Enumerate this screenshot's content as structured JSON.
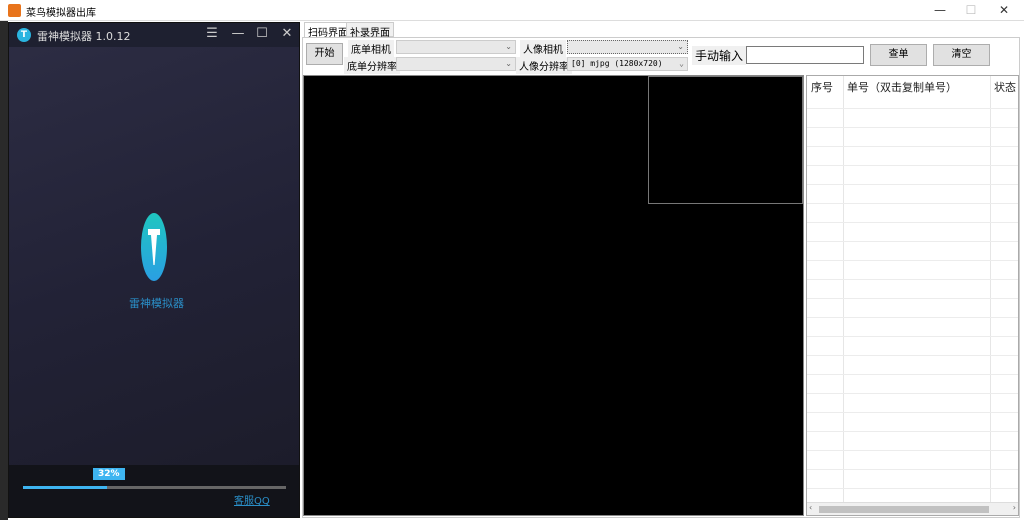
{
  "window": {
    "title": "菜鸟模拟器出库",
    "minimize": "—",
    "maximize": "☐",
    "close": "✕"
  },
  "emulator": {
    "title": "雷神模拟器 1.0.12",
    "logo_letter": "T",
    "menu": "☰",
    "minimize": "—",
    "maximize": "☐",
    "close": "✕",
    "name": "雷神模拟器",
    "progress_label": "32%",
    "progress": 0.32,
    "support_link": "客服QQ"
  },
  "tabs": [
    {
      "label": "扫码界面",
      "active": true
    },
    {
      "label": "补录界面",
      "active": false
    }
  ],
  "toolbar": {
    "start": "开始",
    "base_camera_label": "底单相机",
    "base_camera_value": "",
    "base_res_label": "底单分辨率",
    "base_res_value": "",
    "face_camera_label": "人像相机",
    "face_camera_value": "",
    "face_res_label": "人像分辨率",
    "face_res_value": "[0] mjpg (1280x720)",
    "manual_label": "手动输入",
    "manual_value": "",
    "query": "查单",
    "clear": "清空"
  },
  "table": {
    "columns": [
      "序号",
      "单号（双击复制单号）",
      "状态"
    ]
  }
}
